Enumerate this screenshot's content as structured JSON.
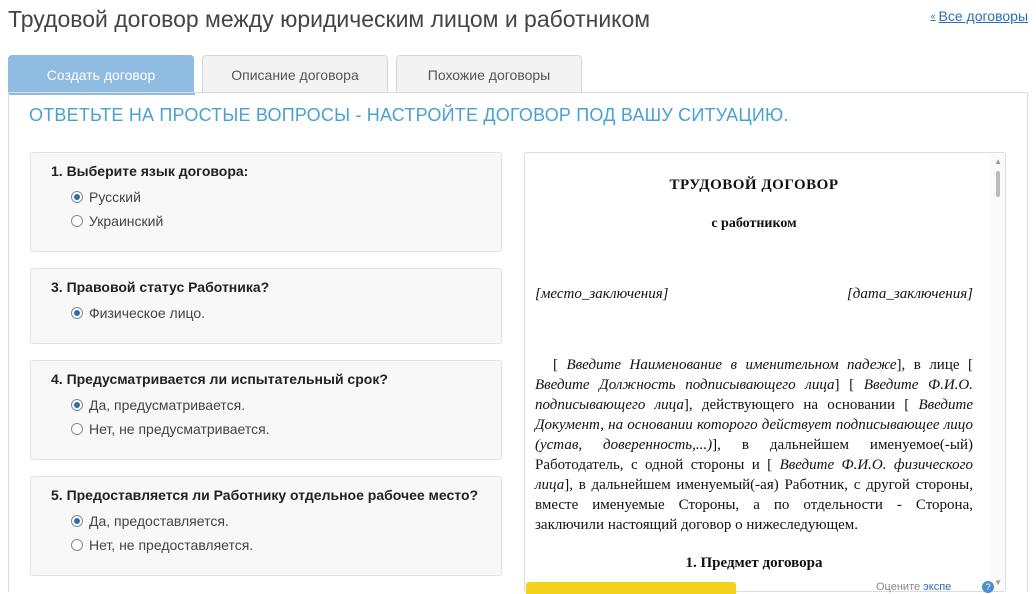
{
  "header": {
    "title": "Трудовой договор между юридическим лицом и работником",
    "all_link": "Все договоры"
  },
  "tabs": [
    {
      "label": "Создать договор",
      "active": true
    },
    {
      "label": "Описание договора",
      "active": false
    },
    {
      "label": "Похожие договоры",
      "active": false
    }
  ],
  "headline": "ОТВЕТЬТЕ НА ПРОСТЫЕ ВОПРОСЫ - НАСТРОЙТЕ ДОГОВОР ПОД ВАШУ СИТУАЦИЮ.",
  "questions": [
    {
      "title": "1. Выберите язык договора:",
      "options": [
        {
          "label": "Русский",
          "checked": true
        },
        {
          "label": "Украинский",
          "checked": false
        }
      ]
    },
    {
      "title": "3. Правовой статус Работника?",
      "options": [
        {
          "label": "Физическое лицо.",
          "checked": true
        }
      ]
    },
    {
      "title": "4. Предусматривается ли испытательный срок?",
      "options": [
        {
          "label": "Да, предусматривается.",
          "checked": true
        },
        {
          "label": "Нет, не предусматривается.",
          "checked": false
        }
      ]
    },
    {
      "title": "5. Предоставляется ли Работнику отдельное рабочее место?",
      "options": [
        {
          "label": "Да, предоставляется.",
          "checked": true
        },
        {
          "label": "Нет, не предоставляется.",
          "checked": false
        }
      ]
    }
  ],
  "document": {
    "title": "ТРУДОВОЙ  ДОГОВОР",
    "subtitle": "с работником",
    "place": "[место_заключения]",
    "date": "[дата_заключения]",
    "p_1": "[ ",
    "p_2": "Введите Наименование в именительном падеже",
    "p_3": "], в лице [ ",
    "p_4": "Введите Должность подписывающего лица",
    "p_5": "] [ ",
    "p_6": "Введите Ф.И.О. подписывающего лица",
    "p_7": "], действующего на основании [ ",
    "p_8": "Введите Документ, на основании которого действует подписывающее лицо (устав, доверенность,...)",
    "p_9": "], в дальнейшем именуемое(-ый) Работодатель, с одной стороны и [ ",
    "p_10": "Введите Ф.И.О. физического лица",
    "p_11": "], в дальнейшем именуемый(-ая) Работник, с другой стороны, вместе именуемые Стороны, а по отдельности - Сторона, заключили настоящий договор о нижеследующем.",
    "section_1": "1. Предмет договора"
  },
  "footer": {
    "text_prefix": "Оцените",
    "link": "экспе"
  }
}
